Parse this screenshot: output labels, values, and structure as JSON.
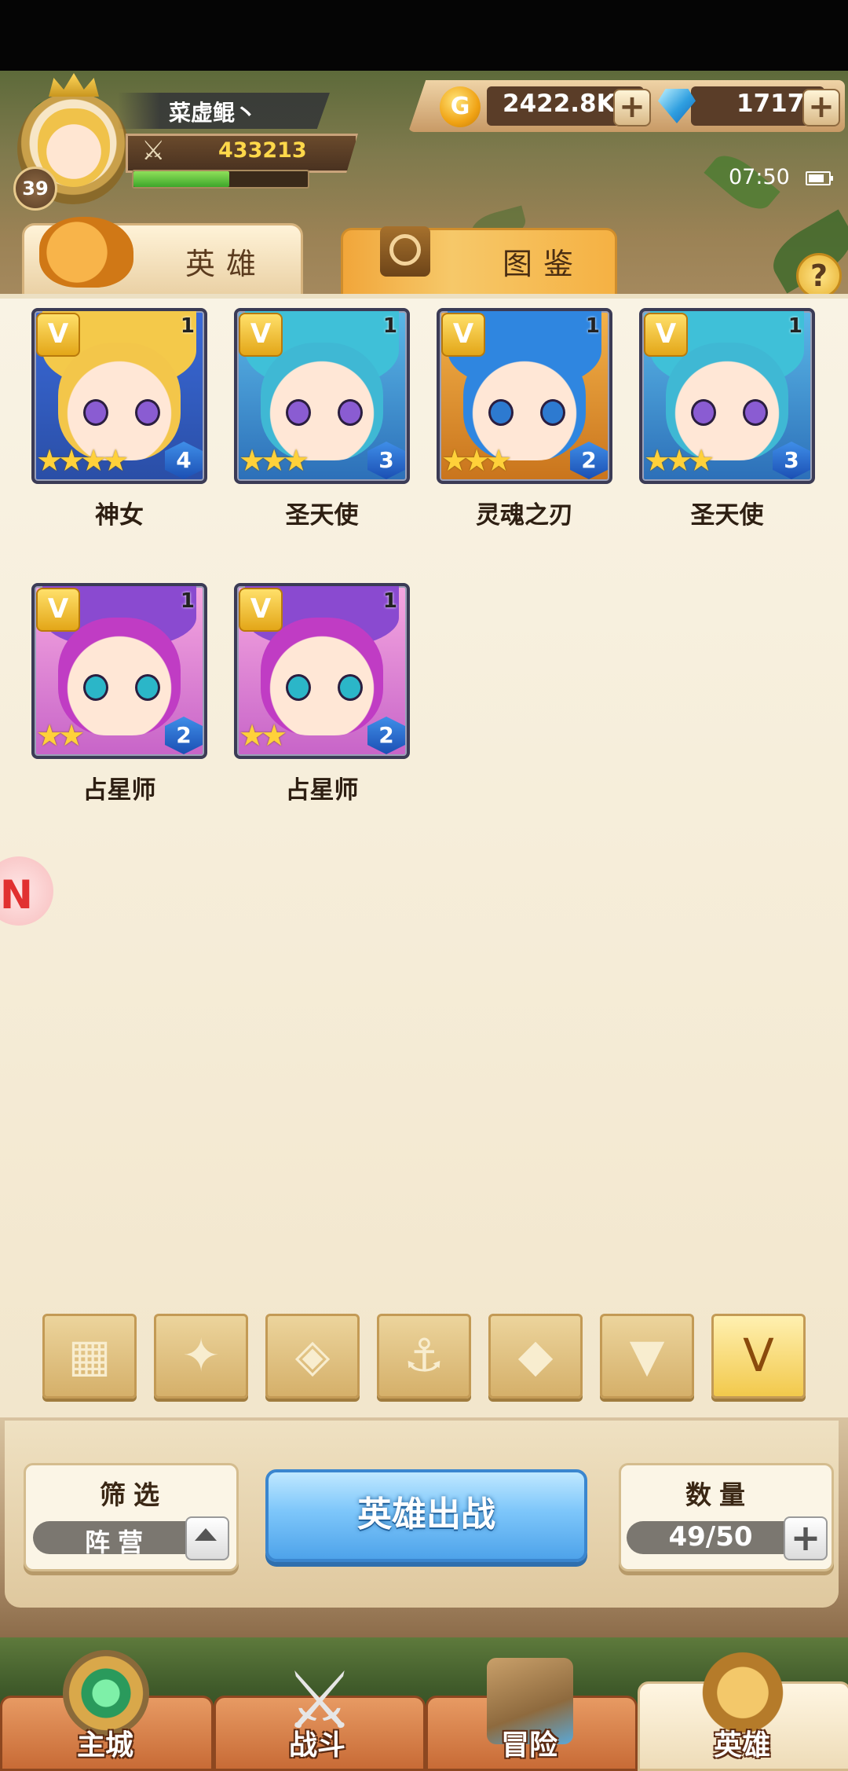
{
  "player": {
    "name": "菜虚鲲丶",
    "level": "39",
    "power": "433213",
    "exp_fraction": 0.55
  },
  "currency": {
    "gold": "2422.8K",
    "gems": "1717",
    "gold_symbol": "G",
    "plus_label": "+"
  },
  "status": {
    "time": "07:50",
    "battery_fraction": 0.8
  },
  "tabs": [
    {
      "label": "英雄",
      "active": true
    },
    {
      "label": "图鉴",
      "active": false
    }
  ],
  "help_label": "?",
  "heroes": [
    {
      "name": "神女",
      "stars": "★★★★",
      "rank": "4",
      "level": "1",
      "faction": "V"
    },
    {
      "name": "圣天使",
      "stars": "★★★",
      "rank": "3",
      "level": "1",
      "faction": "V"
    },
    {
      "name": "灵魂之刃",
      "stars": "★★★",
      "rank": "2",
      "level": "1",
      "faction": "V"
    },
    {
      "name": "圣天使",
      "stars": "★★★",
      "rank": "3",
      "level": "1",
      "faction": "V"
    },
    {
      "name": "占星师",
      "stars": "★★",
      "rank": "2",
      "level": "1",
      "faction": "V"
    },
    {
      "name": "占星师",
      "stars": "★★",
      "rank": "2",
      "level": "1",
      "faction": "V"
    }
  ],
  "faction_filters": [
    {
      "icon": "grid-all-icon"
    },
    {
      "icon": "leaf-spike-icon"
    },
    {
      "icon": "diamond-rune-icon"
    },
    {
      "icon": "anchor-icon"
    },
    {
      "icon": "beast-head-icon"
    },
    {
      "icon": "horned-demon-icon"
    },
    {
      "icon": "wing-v-icon",
      "selected": true
    }
  ],
  "bottom": {
    "filter_title": "筛选",
    "filter_value": "阵营",
    "deploy_label": "英雄出战",
    "count_title": "数量",
    "count_value": "49/50",
    "plus_label": "+"
  },
  "nav": [
    {
      "label": "主城"
    },
    {
      "label": "战斗"
    },
    {
      "label": "冒险"
    },
    {
      "label": "英雄",
      "active": true
    }
  ]
}
